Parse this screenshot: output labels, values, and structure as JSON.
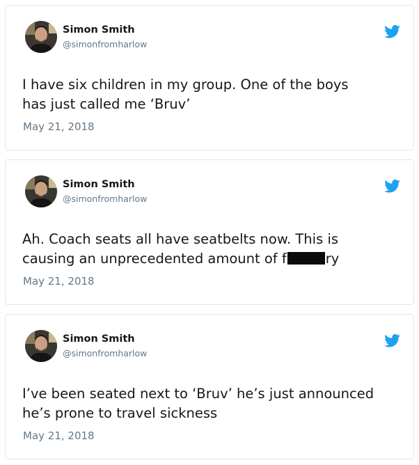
{
  "colors": {
    "twitter_blue": "#1da1f2",
    "text_primary": "#14171a",
    "text_secondary": "#657786",
    "border": "#e1e8ed",
    "redaction": "#0b0b0b"
  },
  "icons": {
    "brand": "twitter-bird-icon",
    "avatar": "profile-photo"
  },
  "tweets": [
    {
      "author_name": "Simon Smith",
      "author_handle": "@simonfromharlow",
      "text_lines": [
        "I have six children in my group. One of the boys",
        "has just called me ‘Bruv’"
      ],
      "date": "May 21, 2018"
    },
    {
      "author_name": "Simon Smith",
      "author_handle": "@simonfromharlow",
      "text_lines": [
        "Ah. Coach seats all have seatbelts now. This is",
        "causing an unprecedented amount of f"
      ],
      "text_after_redaction": "ry",
      "date": "May 21, 2018"
    },
    {
      "author_name": "Simon Smith",
      "author_handle": "@simonfromharlow",
      "text_lines": [
        "I’ve been seated next to ‘Bruv’ he’s just announced",
        "he’s prone to travel sickness"
      ],
      "date": "May 21, 2018"
    }
  ]
}
